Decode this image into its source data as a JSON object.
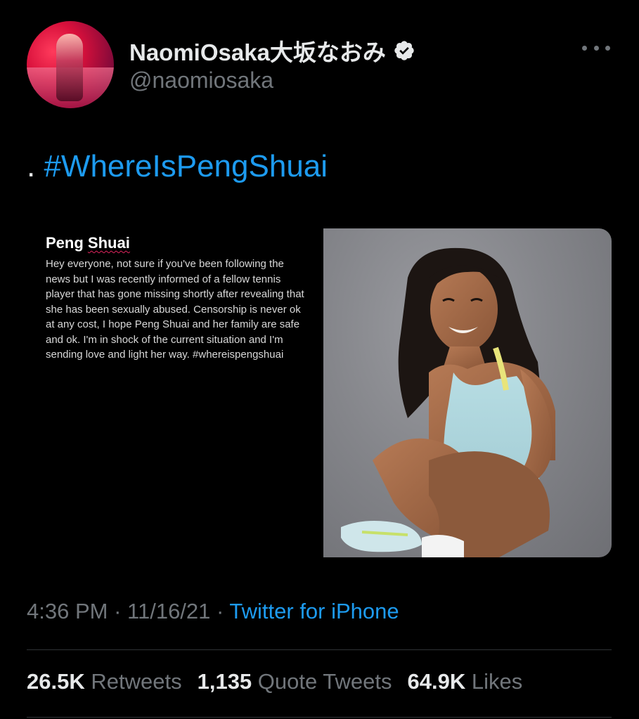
{
  "author": {
    "display_name": "NaomiOsaka大坂なおみ",
    "handle": "@naomiosaka",
    "verified": true,
    "avatar_icon": "profile-photo"
  },
  "menu": {
    "more_icon": "more-horizontal-icon"
  },
  "tweet": {
    "prefix": ". ",
    "hashtag": "#WhereIsPengShuai"
  },
  "media": {
    "note": {
      "title": "Peng Shuai",
      "body": "Hey everyone, not sure if you've been following the news but I was recently informed of a fellow tennis player that has gone missing shortly after revealing that she has been sexually abused. Censorship is never ok at any cost, I hope Peng Shuai and her family are safe and ok. I'm in shock of the current situation and I'm sending love and light her way. #whereispengshuai"
    },
    "photo_icon": "peng-shuai-photo"
  },
  "meta": {
    "time": "4:36 PM",
    "separator": "·",
    "date": "11/16/21",
    "source": "Twitter for iPhone"
  },
  "stats": {
    "retweets_count": "26.5K",
    "retweets_label": "Retweets",
    "quotes_count": "1,135",
    "quotes_label": "Quote Tweets",
    "likes_count": "64.9K",
    "likes_label": "Likes"
  },
  "colors": {
    "background": "#000000",
    "accent": "#1d9bf0",
    "primary_text": "#e7e9ea",
    "secondary_text": "#71767b",
    "divider": "#2f3336"
  }
}
